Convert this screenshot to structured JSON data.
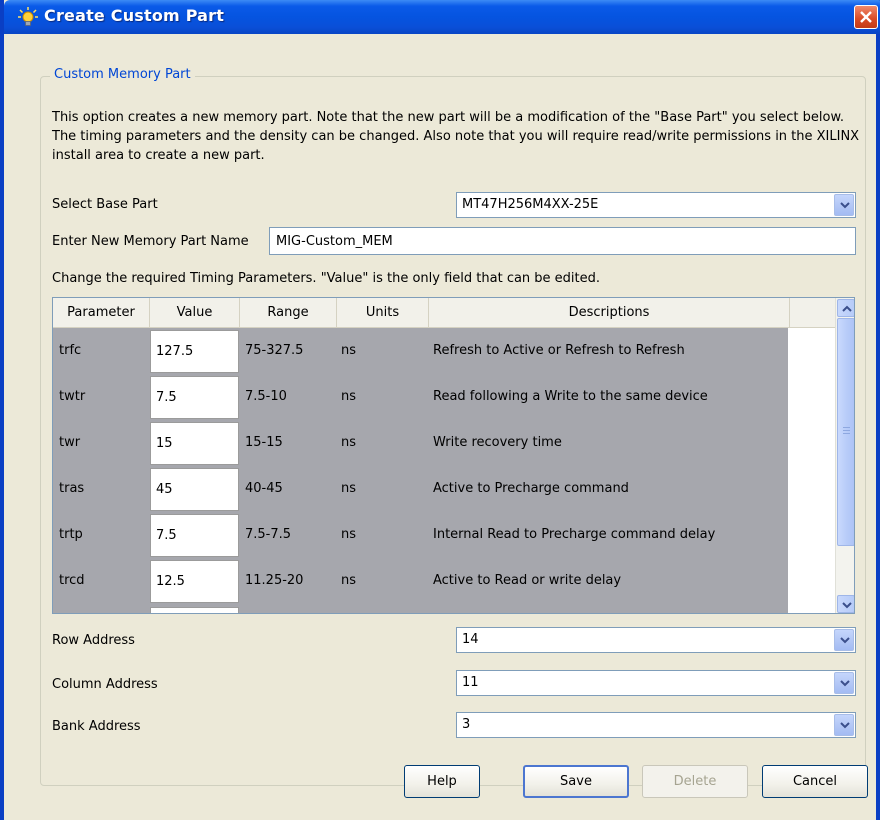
{
  "window": {
    "title": "Create Custom Part"
  },
  "group": {
    "legend": "Custom Memory Part",
    "description": "This option creates a new memory part. Note that the new part will be a modification of the \"Base Part\" you select below. The timing parameters and the density can be changed. Also note that you will require read/write permissions in the XILINX install area to create a new part."
  },
  "base_part": {
    "label": "Select Base Part",
    "value": "MT47H256M4XX-25E"
  },
  "part_name": {
    "label": "Enter New Memory Part Name",
    "value": "MIG-Custom_MEM"
  },
  "timing": {
    "instruction": "Change the required Timing Parameters. \"Value\" is the only field that can be edited.",
    "columns": [
      "Parameter",
      "Value",
      "Range",
      "Units",
      "Descriptions"
    ],
    "rows": [
      {
        "parameter": "trfc",
        "value": "127.5",
        "range": "75-327.5",
        "units": "ns",
        "description": "Refresh to Active or Refresh to Refresh"
      },
      {
        "parameter": "twtr",
        "value": "7.5",
        "range": "7.5-10",
        "units": "ns",
        "description": "Read following a Write to the same device"
      },
      {
        "parameter": "twr",
        "value": "15",
        "range": "15-15",
        "units": "ns",
        "description": "Write recovery time"
      },
      {
        "parameter": "tras",
        "value": "45",
        "range": "40-45",
        "units": "ns",
        "description": "Active to Precharge command"
      },
      {
        "parameter": "trtp",
        "value": "7.5",
        "range": "7.5-7.5",
        "units": "ns",
        "description": "Internal Read to Precharge command delay"
      },
      {
        "parameter": "trcd",
        "value": "12.5",
        "range": "11.25-20",
        "units": "ns",
        "description": "Active to Read or write delay"
      }
    ]
  },
  "addresses": {
    "row": {
      "label": "Row Address",
      "value": "14"
    },
    "column": {
      "label": "Column Address",
      "value": "11"
    },
    "bank": {
      "label": "Bank Address",
      "value": "3"
    }
  },
  "buttons": {
    "help": "Help",
    "save": "Save",
    "delete": "Delete",
    "cancel": "Cancel"
  },
  "colors": {
    "title_bar": "#0554e0",
    "close_button": "#d84a24",
    "legend_text": "#0046d5",
    "table_body": "#a6a7ad",
    "dialog_bg": "#ece9d8"
  },
  "icons": {
    "title": "lightbulb-icon",
    "close": "close-icon",
    "dropdown": "chevron-down-icon",
    "scroll_up": "arrow-up-icon",
    "scroll_down": "arrow-down-icon"
  }
}
